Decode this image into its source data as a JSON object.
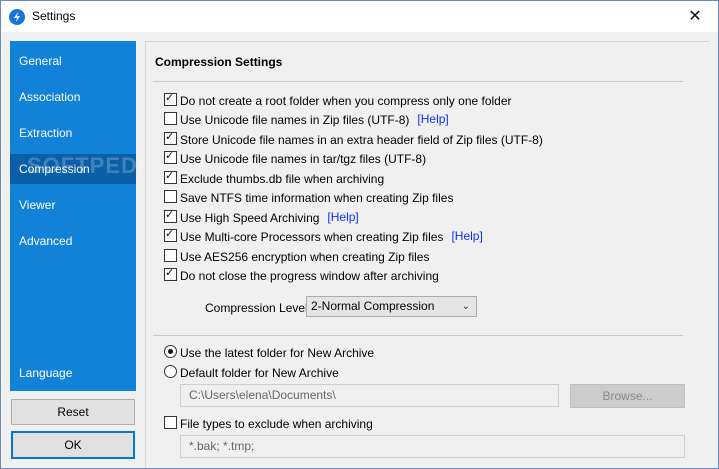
{
  "window": {
    "title": "Settings",
    "close_glyph": "✕"
  },
  "sidebar": {
    "items": [
      {
        "label": "General"
      },
      {
        "label": "Association"
      },
      {
        "label": "Extraction"
      },
      {
        "label": "Compression",
        "active": true
      },
      {
        "label": "Viewer"
      },
      {
        "label": "Advanced"
      }
    ],
    "language_label": "Language",
    "watermark": "SOFTPEDIA"
  },
  "buttons": {
    "reset": "Reset",
    "ok": "OK",
    "browse": "Browse..."
  },
  "compression": {
    "section_title": "Compression Settings",
    "options": [
      {
        "label": "Do not create a root folder when you compress only one folder",
        "checked": true
      },
      {
        "label": "Use Unicode file names in Zip files (UTF-8)",
        "checked": false,
        "help": "[Help]"
      },
      {
        "label": "Store Unicode file names in an extra header field of Zip files (UTF-8)",
        "checked": true
      },
      {
        "label": "Use Unicode file names in tar/tgz files (UTF-8)",
        "checked": true
      },
      {
        "label": "Exclude thumbs.db file when archiving",
        "checked": true
      },
      {
        "label": "Save NTFS time information when creating Zip files",
        "checked": false
      },
      {
        "label": "Use High Speed Archiving",
        "checked": true,
        "help": "[Help]"
      },
      {
        "label": "Use Multi-core Processors when creating Zip files",
        "checked": true,
        "help": "[Help]"
      },
      {
        "label": "Use AES256 encryption when creating Zip files",
        "checked": false
      },
      {
        "label": "Do not close the progress window after archiving",
        "checked": true
      }
    ],
    "level_label": "Compression Level:",
    "level_value": "2-Normal Compression"
  },
  "archive_folder": {
    "latest_label": "Use the latest folder for New Archive",
    "latest_selected": true,
    "default_label": "Default folder for New Archive",
    "default_selected": false,
    "default_path": "C:\\Users\\elena\\Documents\\"
  },
  "exclude": {
    "label": "File types to exclude when archiving",
    "checked": false,
    "value": "*.bak; *.tmp;"
  },
  "colors": {
    "sidebar": "#1282d9",
    "sidebar_active": "#0a5fa8",
    "help_link": "#0b30ff",
    "ok_border": "#0078d7"
  }
}
